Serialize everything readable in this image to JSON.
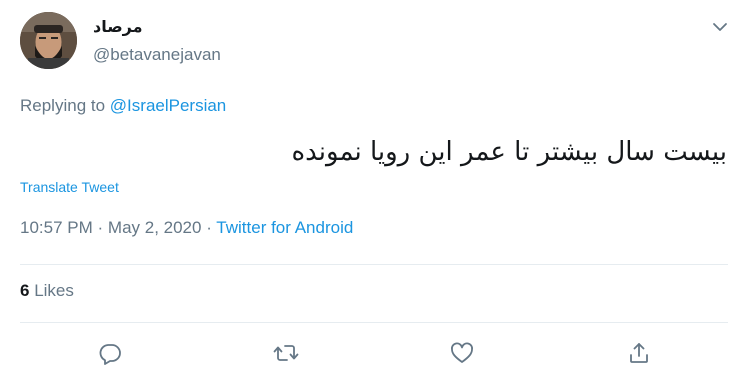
{
  "user": {
    "display_name": "مرصاد",
    "handle": "@betavanejavan"
  },
  "reply": {
    "prefix": "Replying to",
    "mention": "@IsraelPersian"
  },
  "tweet": {
    "text": "بیست سال بیشتر تا عمر این رویا نمونده",
    "translate_label": "Translate Tweet"
  },
  "meta": {
    "time": "10:57 PM",
    "date": "May 2, 2020",
    "separator": "·",
    "source": "Twitter for Android"
  },
  "stats": {
    "likes_count": "6",
    "likes_label": "Likes"
  },
  "icons": {
    "caret": "chevron-down-icon",
    "reply": "reply-icon",
    "retweet": "retweet-icon",
    "like": "heart-icon",
    "share": "share-icon"
  },
  "colors": {
    "link": "#1b95e0",
    "secondary_text": "#657786",
    "primary_text": "#14171a",
    "divider": "#e6ecf0"
  }
}
